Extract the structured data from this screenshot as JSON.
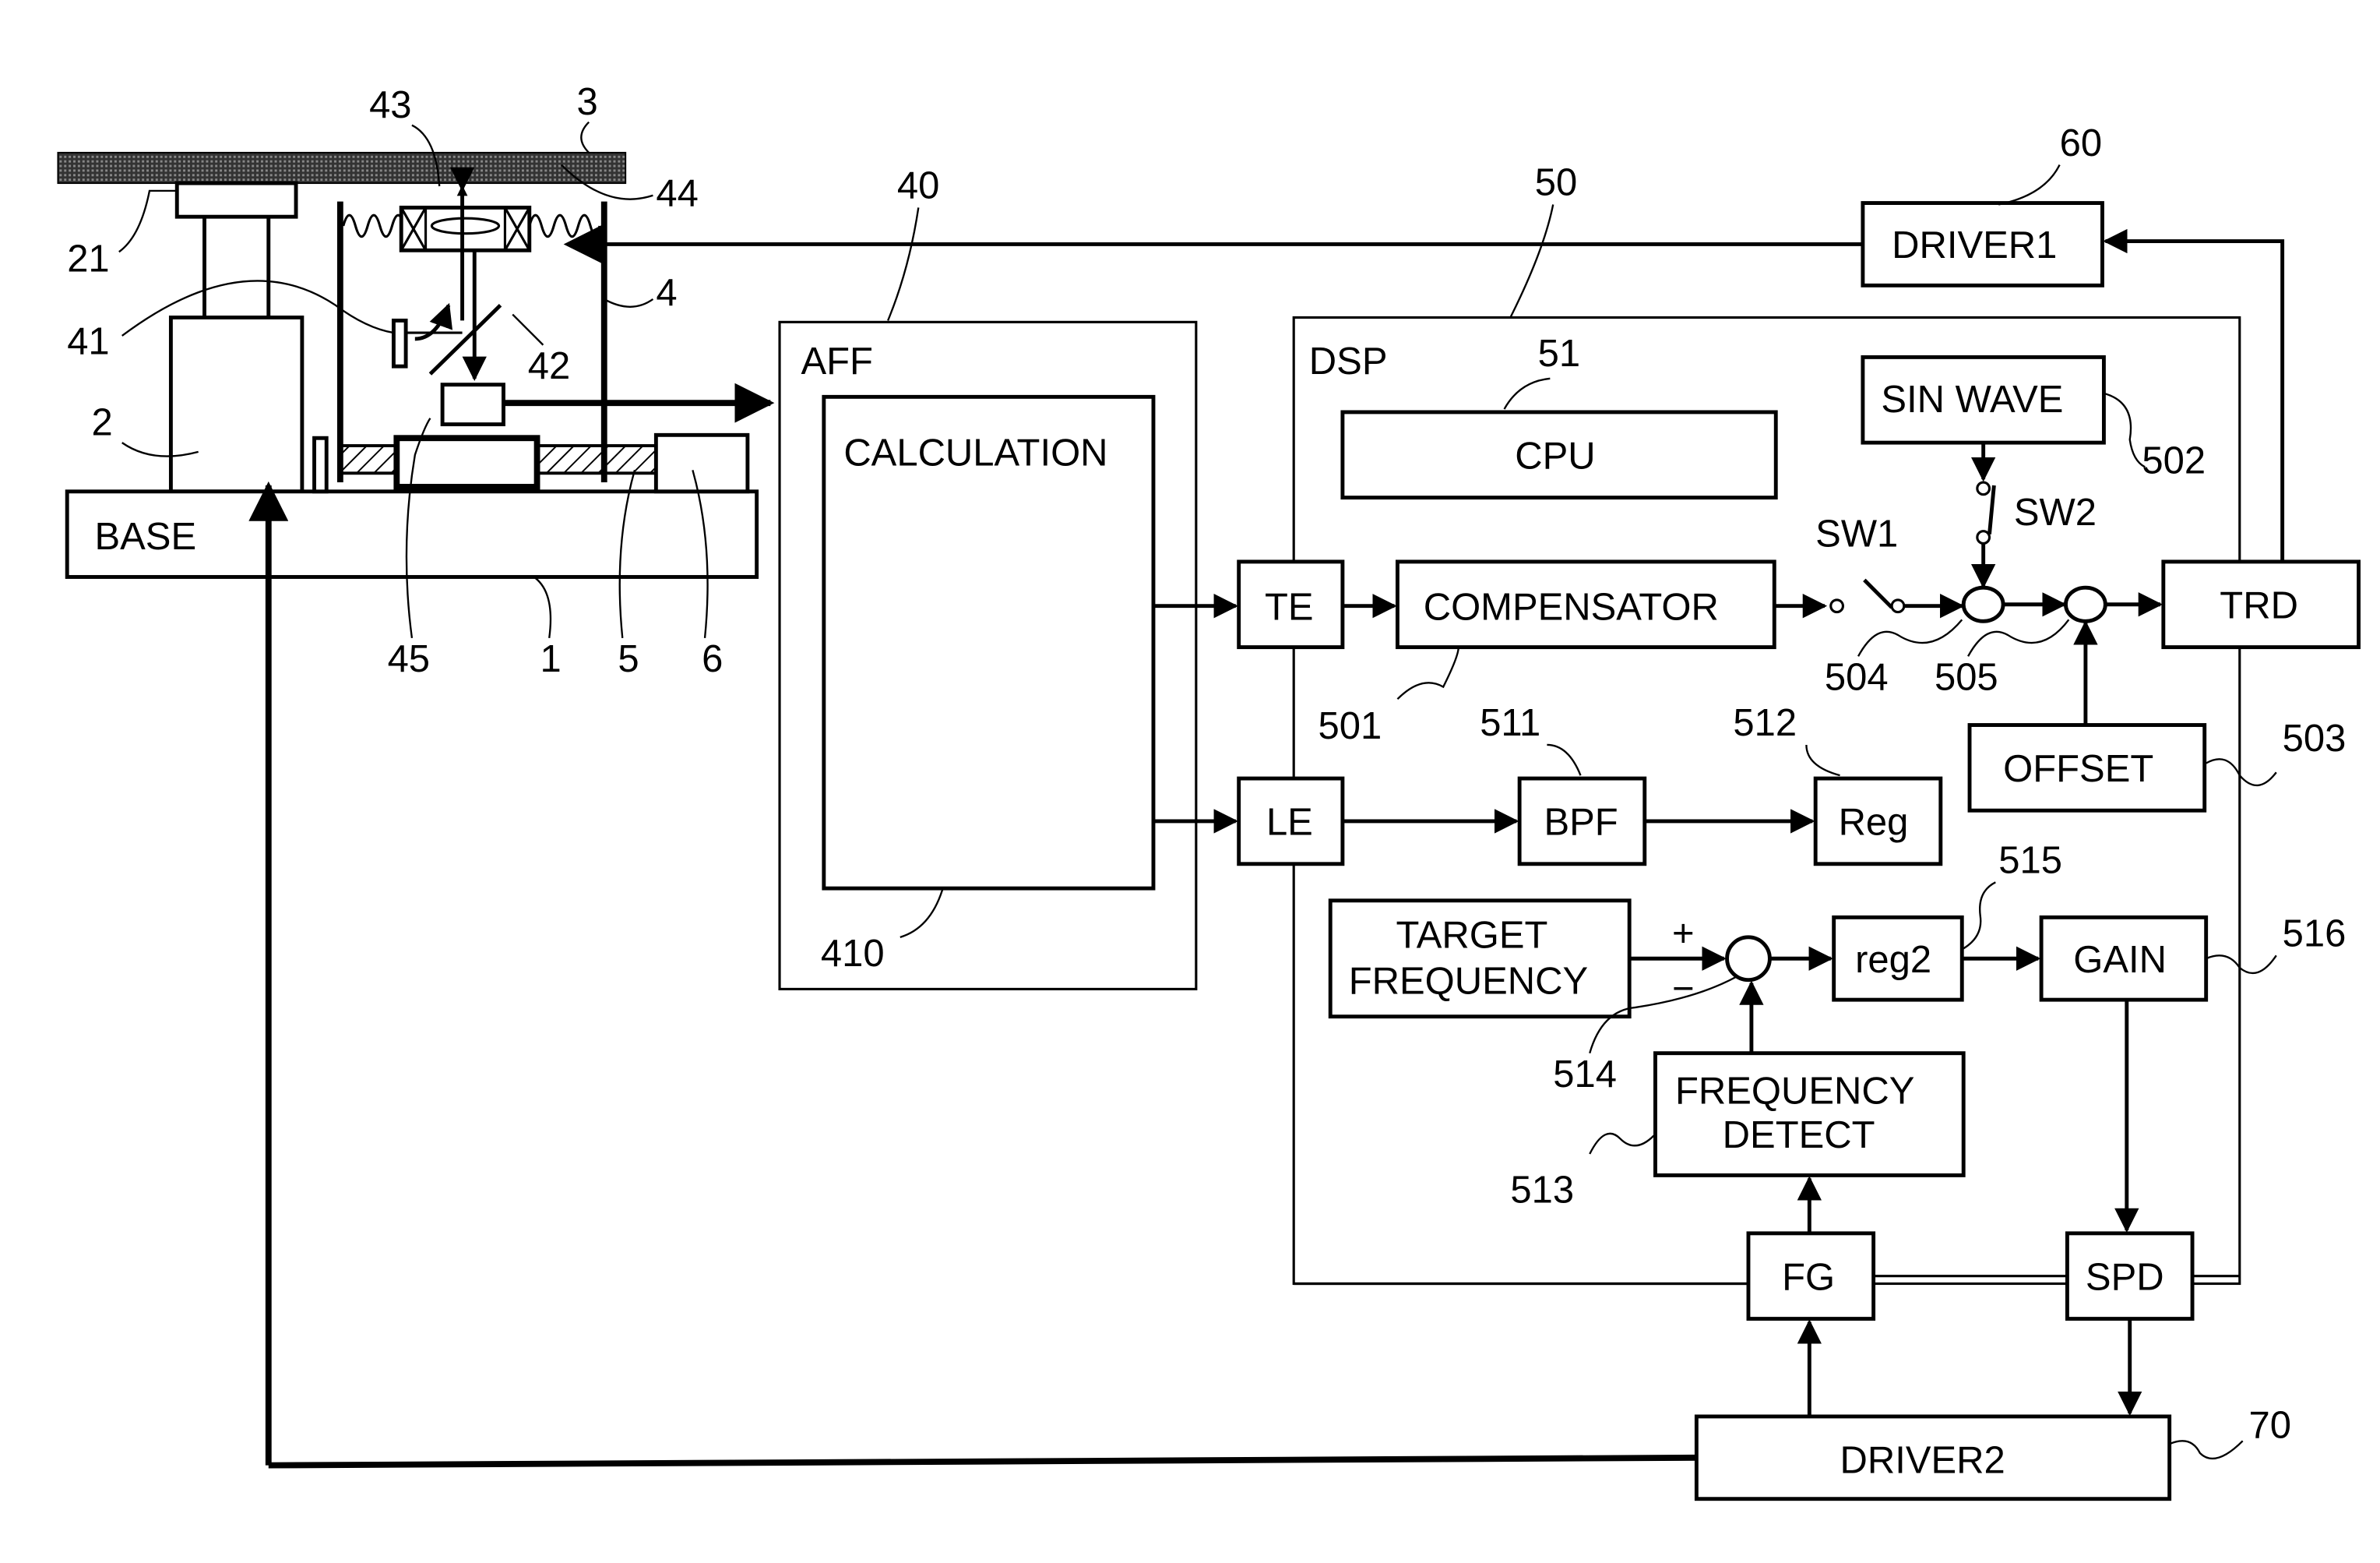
{
  "diagram": {
    "mechanism": {
      "base_label": "BASE",
      "ref_1": "1",
      "ref_2": "2",
      "ref_3": "3",
      "ref_4": "4",
      "ref_5": "5",
      "ref_6": "6",
      "ref_21": "21",
      "ref_41": "41",
      "ref_42": "42",
      "ref_43": "43",
      "ref_44": "44",
      "ref_45": "45"
    },
    "aff": {
      "label": "AFF",
      "ref": "40",
      "calc_label": "CALCULATION",
      "calc_ref": "410"
    },
    "dsp": {
      "label": "DSP",
      "ref": "50",
      "cpu_label": "CPU",
      "cpu_ref": "51",
      "te_label": "TE",
      "le_label": "LE",
      "compensator_label": "COMPENSATOR",
      "compensator_ref": "501",
      "sinwave_label": "SIN WAVE",
      "sinwave_ref": "502",
      "offset_label": "OFFSET",
      "offset_ref": "503",
      "sum1_ref": "504",
      "sum2_ref": "505",
      "sw1_label": "SW1",
      "sw2_label": "SW2",
      "trd_label": "TRD",
      "bpf_label": "BPF",
      "bpf_ref": "511",
      "reg_label": "Reg",
      "reg_ref": "512",
      "target_freq_line1": "TARGET",
      "target_freq_line2": "FREQUENCY",
      "plus_sign": "+",
      "minus_sign": "−",
      "sum3_ref": "514",
      "reg2_label": "reg2",
      "reg2_ref": "515",
      "gain_label": "GAIN",
      "gain_ref": "516",
      "freq_detect_line1": "FREQUENCY",
      "freq_detect_line2": "DETECT",
      "freq_detect_ref": "513",
      "fg_label": "FG",
      "spd_label": "SPD"
    },
    "driver1": {
      "label": "DRIVER1",
      "ref": "60"
    },
    "driver2": {
      "label": "DRIVER2",
      "ref": "70"
    }
  }
}
